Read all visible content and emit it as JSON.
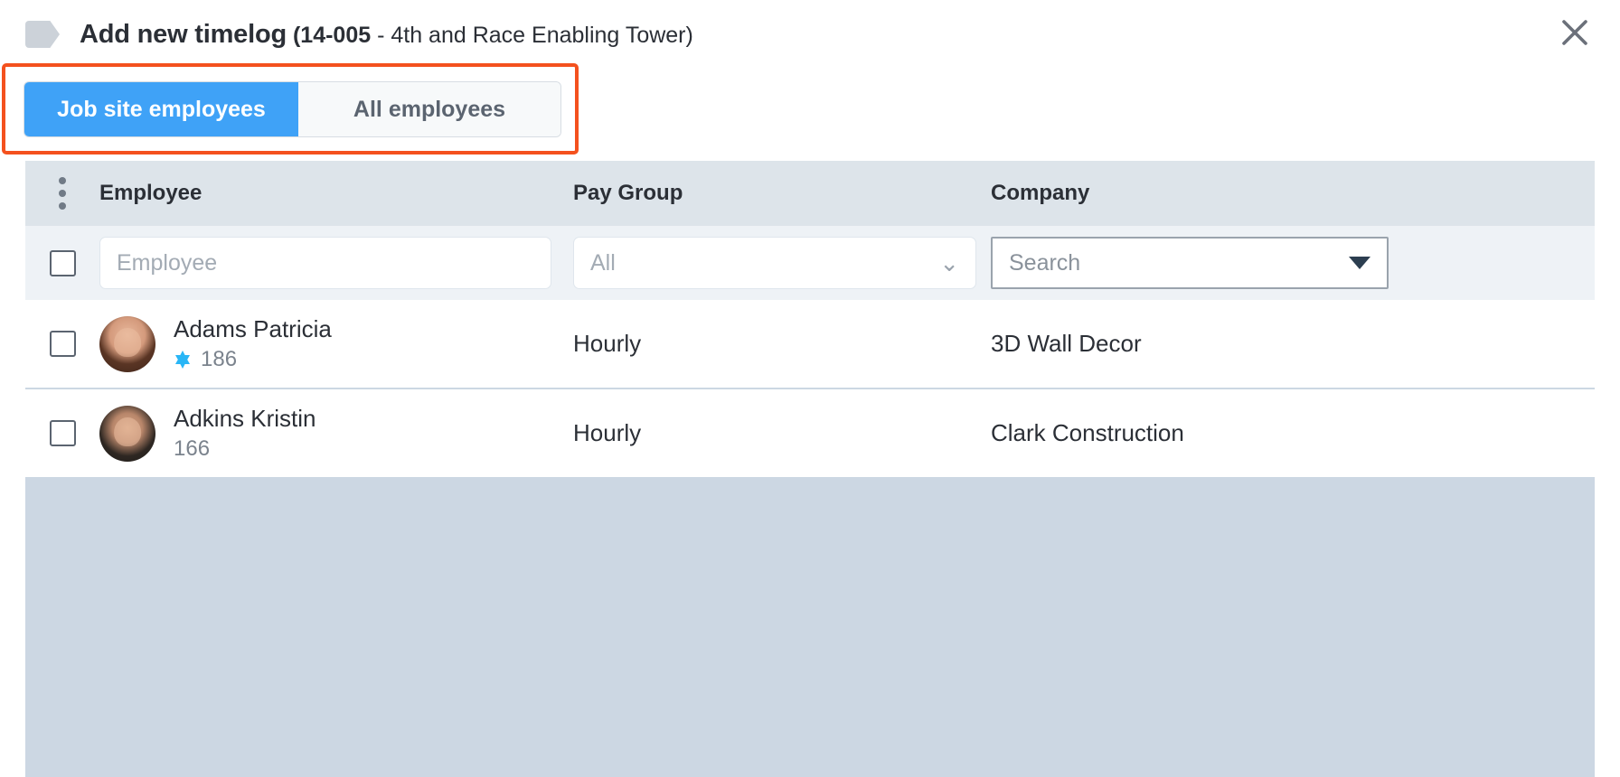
{
  "header": {
    "tag_icon": "tag-icon",
    "title": "Add new timelog",
    "subtitle_code": "(14-005",
    "subtitle_rest": " - 4th and Race Enabling Tower)",
    "close_icon": "close-icon"
  },
  "tabs": {
    "highlight_color": "#f4511e",
    "active_color": "#3fa2f7",
    "items": [
      {
        "label": "Job site employees",
        "active": true
      },
      {
        "label": "All employees",
        "active": false
      }
    ]
  },
  "table": {
    "menu_icon": "kebab-menu-icon",
    "columns": [
      {
        "label": "Employee"
      },
      {
        "label": "Pay Group"
      },
      {
        "label": "Company"
      }
    ],
    "filters": {
      "select_all_checkbox": "",
      "employee_placeholder": "Employee",
      "pay_group_value": "All",
      "pay_group_chevron": "chevron-down-icon",
      "company_value": "Search",
      "company_chevron": "triangle-down-icon"
    },
    "rows": [
      {
        "checkbox": "",
        "avatar": "avatar-adams-patricia",
        "name": "Adams Patricia",
        "badge": "star-icon",
        "has_badge": true,
        "number": "186",
        "pay_group": "Hourly",
        "company": "3D Wall Decor"
      },
      {
        "checkbox": "",
        "avatar": "avatar-adkins-kristin",
        "name": "Adkins Kristin",
        "badge": "",
        "has_badge": false,
        "number": "166",
        "pay_group": "Hourly",
        "company": "Clark Construction"
      }
    ]
  }
}
